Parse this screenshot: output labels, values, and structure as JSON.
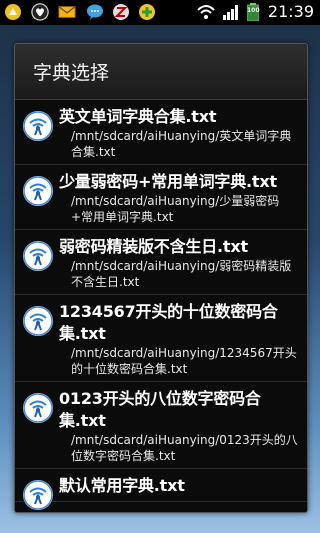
{
  "status_bar": {
    "time": "21:39",
    "battery_level": "100",
    "left_icons": [
      "android-icon",
      "heart-icon",
      "mail-icon",
      "chat-icon",
      "z-app-icon",
      "plus-app-icon"
    ],
    "right_icons": [
      "wifi-icon",
      "signal-icon",
      "battery-icon"
    ]
  },
  "dialog": {
    "title": "字典选择",
    "items": [
      {
        "name": "英文单词字典合集.txt",
        "path": "/mnt/sdcard/aiHuanying/英文单词字典合集.txt"
      },
      {
        "name": "少量弱密码+常用单词字典.txt",
        "path": "/mnt/sdcard/aiHuanying/少量弱密码+常用单词字典.txt"
      },
      {
        "name": "弱密码精装版不含生日.txt",
        "path": "/mnt/sdcard/aiHuanying/弱密码精装版不含生日.txt"
      },
      {
        "name": "1234567开头的十位数密码合集.txt",
        "path": "/mnt/sdcard/aiHuanying/1234567开头的十位数密码合集.txt"
      },
      {
        "name": "0123开头的八位数字密码合集.txt",
        "path": "/mnt/sdcard/aiHuanying/0123开头的八位数字密码合集.txt"
      },
      {
        "name": "默认常用字典.txt",
        "path": ""
      }
    ]
  }
}
